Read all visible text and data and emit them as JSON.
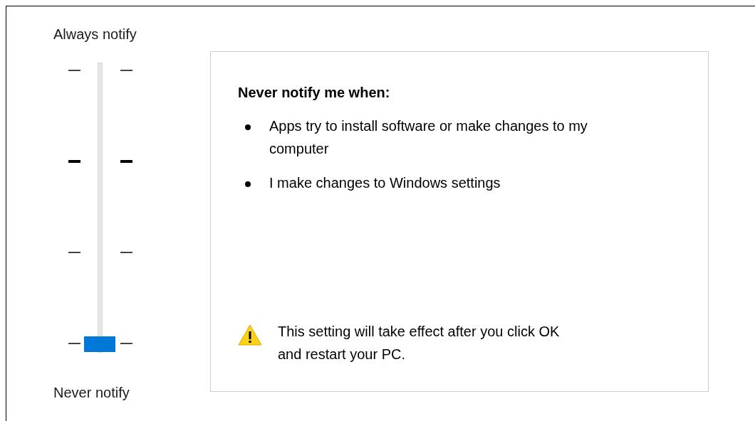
{
  "slider": {
    "top_label": "Always notify",
    "bottom_label": "Never notify",
    "level": 0,
    "ticks": [
      {
        "major": false
      },
      {
        "major": true
      },
      {
        "major": false
      },
      {
        "major": false
      }
    ]
  },
  "description": {
    "heading": "Never notify me when:",
    "bullets": [
      "Apps try to install software or make changes to my computer",
      "I make changes to Windows settings"
    ],
    "warning": "This setting will take effect after you click OK and restart your PC."
  }
}
